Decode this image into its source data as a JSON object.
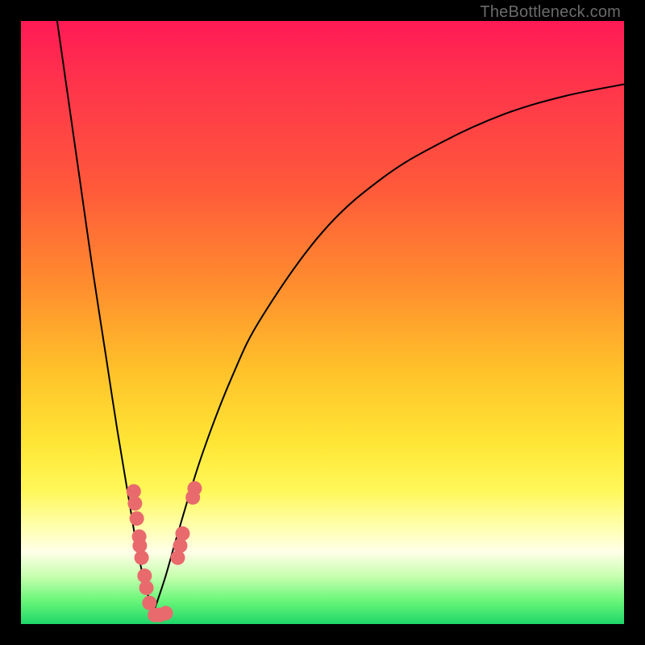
{
  "watermark": "TheBottleneck.com",
  "chart_data": {
    "type": "line",
    "title": "",
    "xlabel": "",
    "ylabel": "",
    "xlim": [
      0,
      100
    ],
    "ylim": [
      0,
      100
    ],
    "grid": false,
    "legend": false,
    "annotations": [],
    "description": "Two smooth black curves forming a V shape on a vertical heat gradient (red high → green low). Left curve descends from top-left to the valley near x≈22, right curve rises from the valley toward the upper right. Pink beads cluster on both curves near the valley.",
    "series": [
      {
        "name": "left-curve",
        "x": [
          6,
          8,
          10,
          12,
          14,
          16,
          18,
          19,
          20,
          21,
          22
        ],
        "y": [
          100,
          86,
          72,
          58,
          45,
          32,
          20,
          14,
          9,
          5,
          2
        ]
      },
      {
        "name": "right-curve",
        "x": [
          22,
          24,
          26,
          30,
          35,
          40,
          50,
          60,
          70,
          80,
          90,
          100
        ],
        "y": [
          2,
          8,
          15,
          28,
          41,
          51,
          65,
          74,
          80,
          84.5,
          87.5,
          89.5
        ]
      }
    ],
    "beads": {
      "color": "#e96a6d",
      "left_cluster": [
        {
          "x": 18.7,
          "y": 22
        },
        {
          "x": 18.9,
          "y": 20
        },
        {
          "x": 19.2,
          "y": 17.5
        },
        {
          "x": 19.6,
          "y": 14.5
        },
        {
          "x": 19.7,
          "y": 13
        },
        {
          "x": 20.0,
          "y": 11
        },
        {
          "x": 20.5,
          "y": 8
        },
        {
          "x": 20.8,
          "y": 6
        },
        {
          "x": 21.3,
          "y": 3.5
        },
        {
          "x": 22.2,
          "y": 1.5
        },
        {
          "x": 23.0,
          "y": 1.5
        },
        {
          "x": 24.0,
          "y": 1.8
        }
      ],
      "right_cluster": [
        {
          "x": 26.0,
          "y": 11
        },
        {
          "x": 26.4,
          "y": 13
        },
        {
          "x": 26.8,
          "y": 15
        },
        {
          "x": 28.5,
          "y": 21
        },
        {
          "x": 28.8,
          "y": 22.5
        }
      ]
    }
  }
}
